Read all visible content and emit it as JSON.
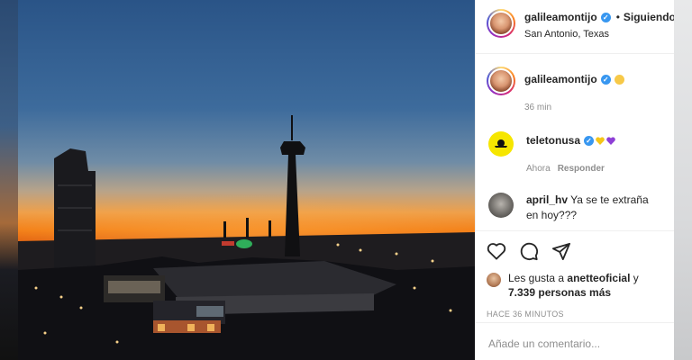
{
  "post": {
    "username": "galileamontijo",
    "separator": "•",
    "follow_status": "Siguiendo",
    "location": "San Antonio, Texas"
  },
  "caption": {
    "username": "galileamontijo",
    "time": "36 min"
  },
  "comments": [
    {
      "username": "teletonusa",
      "text": "",
      "time": "Ahora",
      "reply_label": "Responder"
    },
    {
      "username": "april_hv",
      "text": "Ya se te extraña en hoy???"
    }
  ],
  "likes": {
    "prefix": "Les gusta a",
    "user": "anetteoficial",
    "middle": "y",
    "count_text": "7.339 personas más"
  },
  "timestamp": "HACE 36 MINUTOS",
  "add_comment": {
    "placeholder": "Añade un comentario..."
  },
  "icons": {
    "like": "heart-outline-icon",
    "comment": "comment-bubble-icon",
    "share": "paper-plane-icon"
  },
  "colors": {
    "verified": "#3897f0",
    "secondary_text": "#8e8e8e",
    "sky_top": "#2d5a8f",
    "horizon": "#f08a1c"
  }
}
